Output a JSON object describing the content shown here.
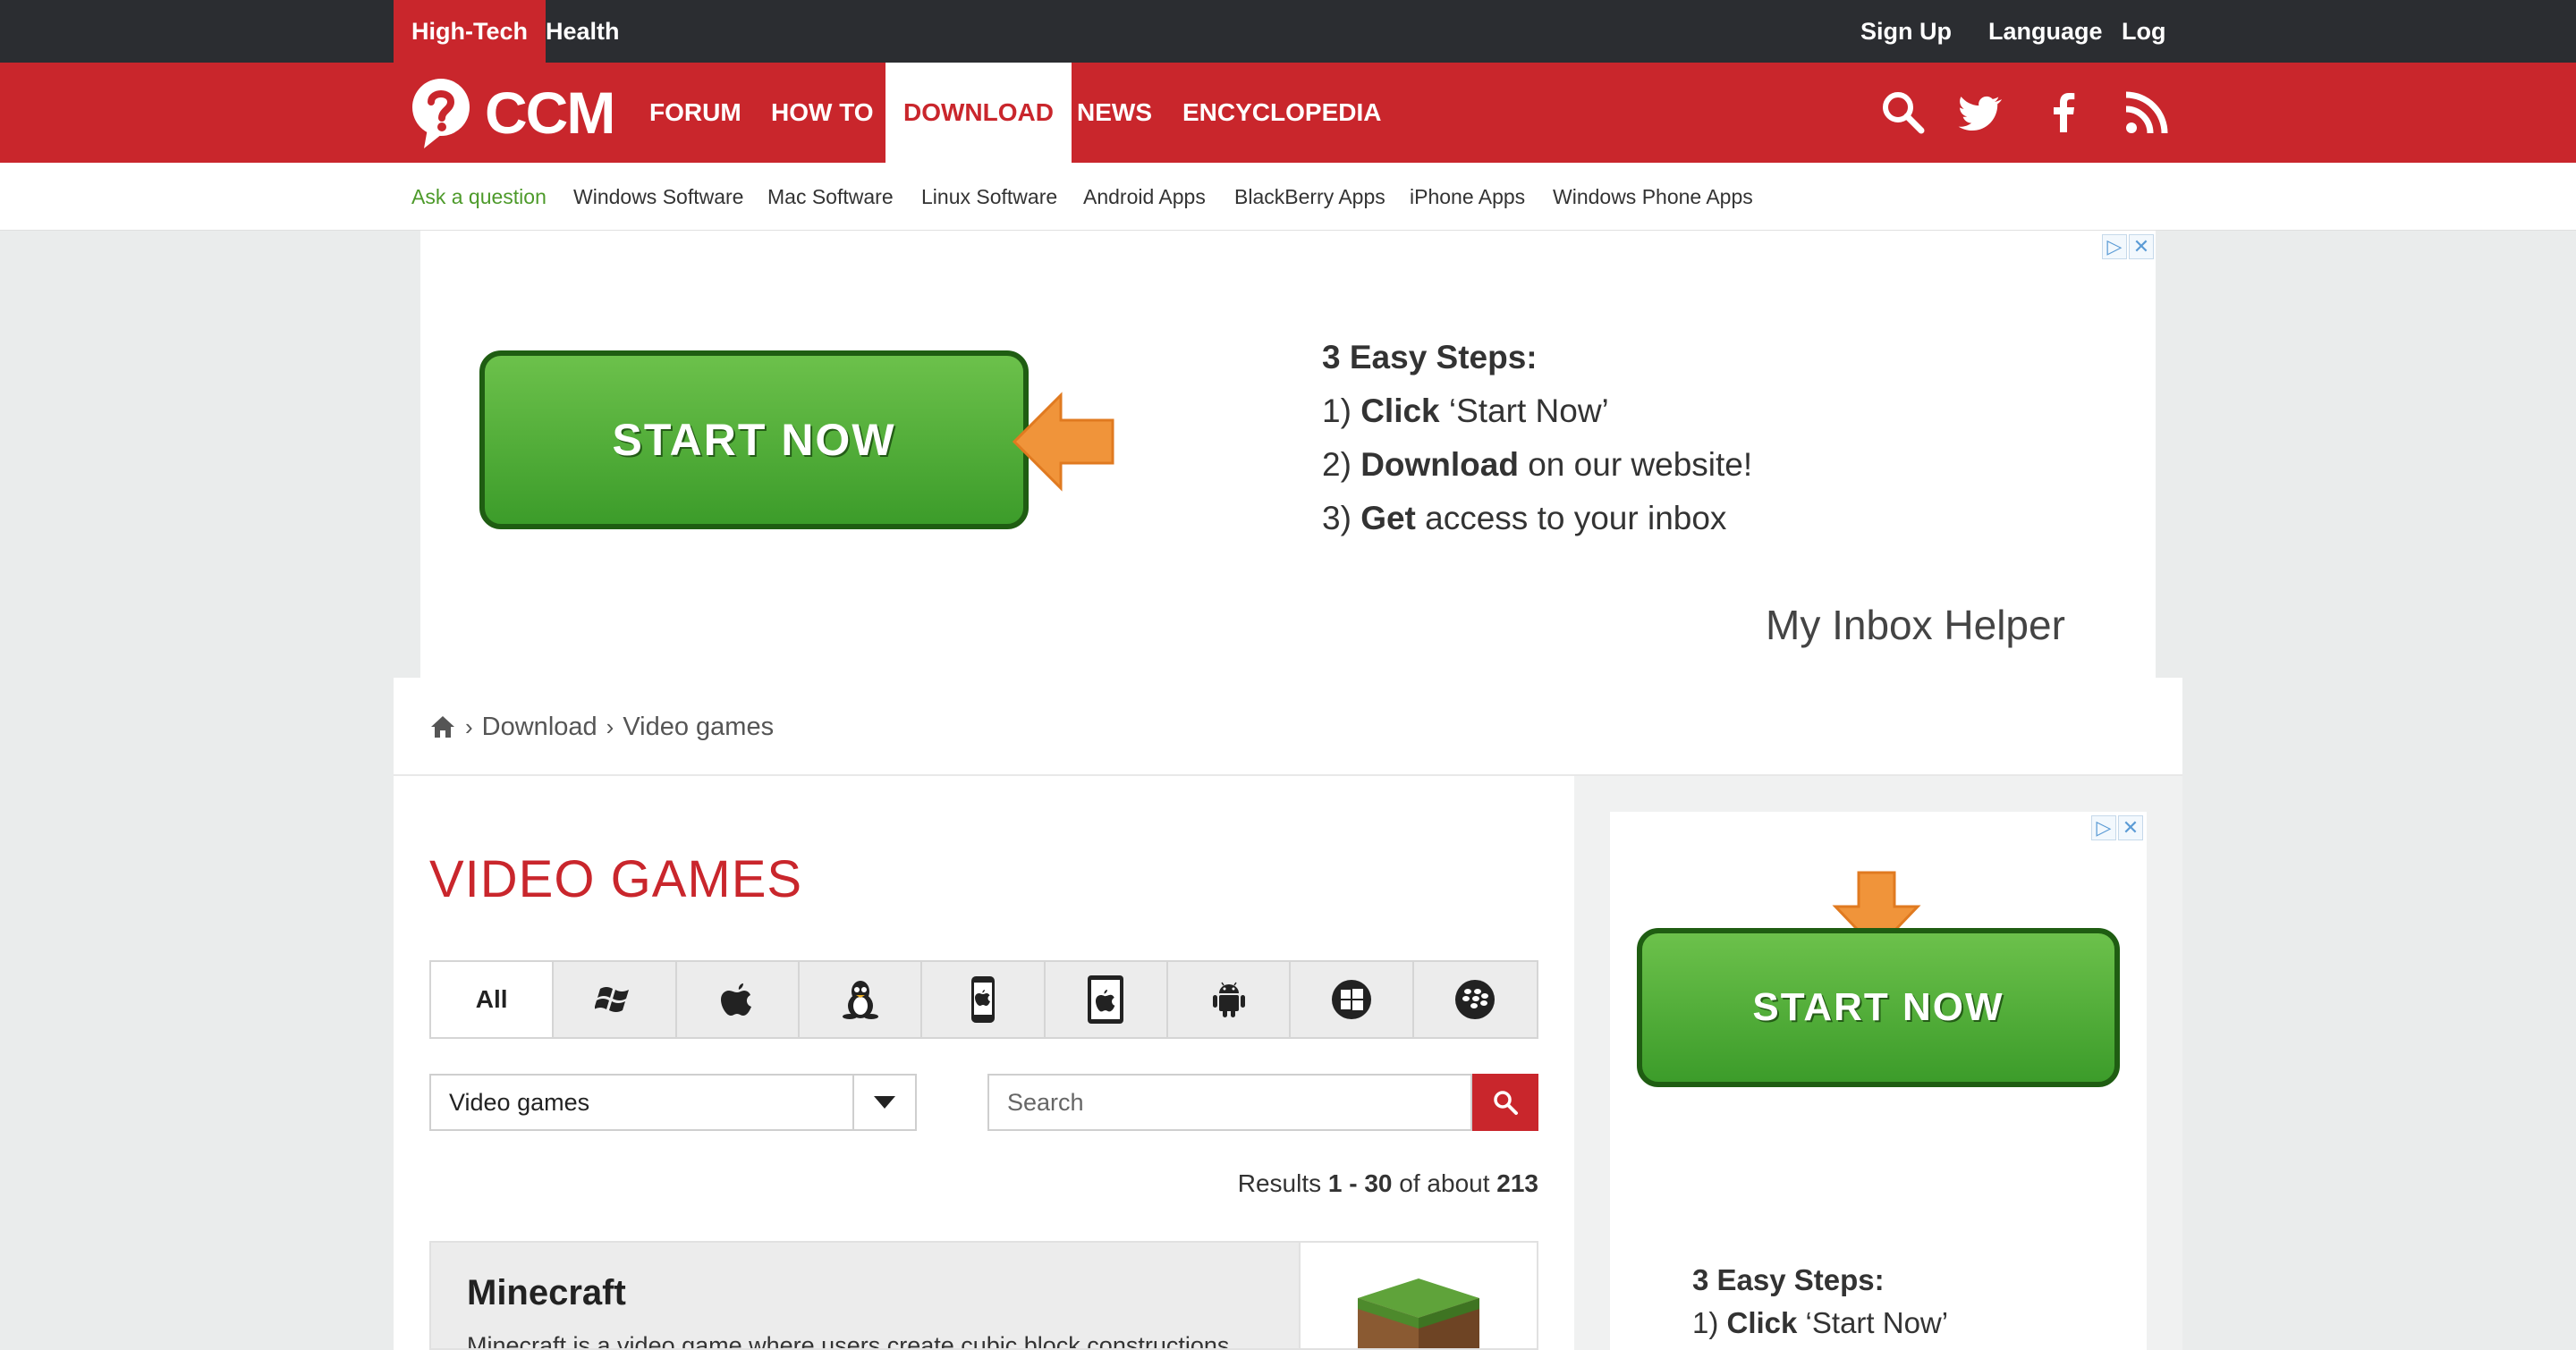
{
  "topbar": {
    "left_links": [
      "High-Tech",
      "Health"
    ],
    "right_links": [
      "Sign Up",
      "Language",
      "Log In"
    ]
  },
  "logo": {
    "text": "CCM"
  },
  "mainnav": {
    "items": [
      "FORUM",
      "HOW TO",
      "DOWNLOAD",
      "NEWS",
      "ENCYCLOPEDIA"
    ],
    "active": "DOWNLOAD",
    "icons": [
      "search-icon",
      "twitter-icon",
      "facebook-icon",
      "rss-icon"
    ]
  },
  "subnav": {
    "items": [
      "Ask a question",
      "Windows Software",
      "Mac Software",
      "Linux Software",
      "Android Apps",
      "BlackBerry Apps",
      "iPhone Apps",
      "Windows Phone Apps"
    ]
  },
  "ad_top": {
    "button_label": "START NOW",
    "steps_title": "3 Easy Steps:",
    "step1_num": "1)",
    "step1_bold": "Click",
    "step1_rest": " ‘Start Now’",
    "step2_num": "2)",
    "step2_bold": "Download",
    "step2_rest": " on our website!",
    "step3_num": "3)",
    "step3_bold": "Get",
    "step3_rest": " access to your inbox",
    "brand": "My Inbox Helper"
  },
  "breadcrumb": {
    "items": [
      "Download",
      "Video games"
    ]
  },
  "page": {
    "title": "VIDEO GAMES"
  },
  "platform_tabs": {
    "all_label": "All",
    "icons": [
      "windows-icon",
      "apple-icon",
      "linux-icon",
      "iphone-icon",
      "ipad-icon",
      "android-icon",
      "windows-phone-icon",
      "blackberry-icon"
    ]
  },
  "category_select": {
    "value": "Video games"
  },
  "search": {
    "placeholder": "Search"
  },
  "results": {
    "prefix": "Results ",
    "range": "1 - 30",
    "middle": " of about ",
    "total": "213"
  },
  "items": [
    {
      "title": "Minecraft",
      "description": "Minecraft is a video game where users create cubic block constructions"
    }
  ],
  "side_ad": {
    "button_label": "START NOW",
    "steps_title": "3 Easy Steps:",
    "step1_num": "1)",
    "step1_bold": "Click",
    "step1_rest": " ‘Start Now’"
  },
  "colors": {
    "brand_red": "#c9262c",
    "topbar": "#2b2d31",
    "green": "#4d9a2a"
  }
}
